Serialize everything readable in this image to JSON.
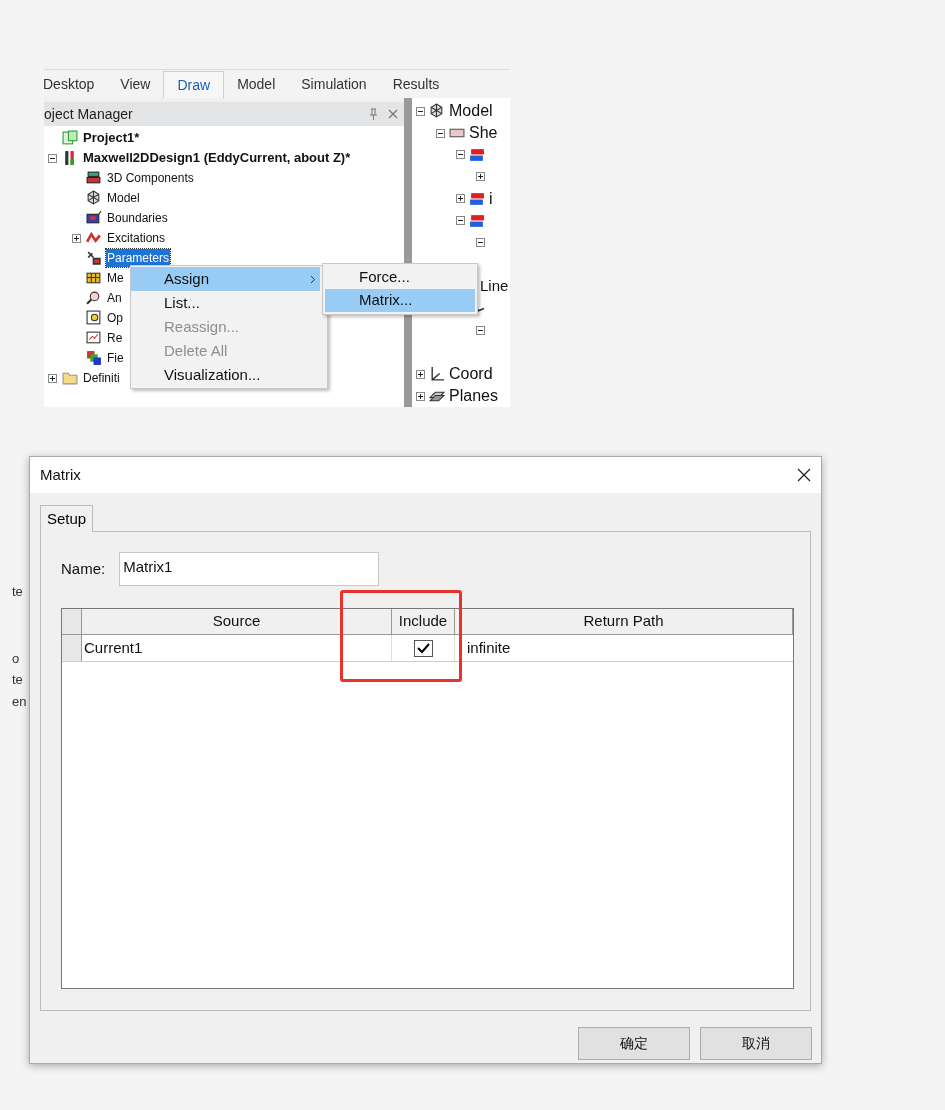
{
  "toolbar": {
    "ribbon_tabs": [
      {
        "label": "Desktop",
        "selected": false
      },
      {
        "label": "View",
        "selected": false
      },
      {
        "label": "Draw",
        "selected": true
      },
      {
        "label": "Model",
        "selected": false
      },
      {
        "label": "Simulation",
        "selected": false
      },
      {
        "label": "Results",
        "selected": false
      }
    ]
  },
  "project_manager": {
    "title": "oject Manager",
    "tree": [
      {
        "label": "Project1*",
        "kind": "project",
        "bold": true,
        "selected": false
      },
      {
        "label": "Maxwell2DDesign1 (EddyCurrent, about Z)*",
        "kind": "design",
        "bold": true,
        "expanded": true,
        "selected": false,
        "children": [
          {
            "label": "3D Components",
            "kind": "components",
            "selected": false
          },
          {
            "label": "Model",
            "kind": "model",
            "selected": false
          },
          {
            "label": "Boundaries",
            "kind": "boundaries",
            "selected": false
          },
          {
            "label": "Excitations",
            "kind": "excitations",
            "expanded": false,
            "selected": false
          },
          {
            "label": "Parameters",
            "kind": "parameters",
            "selected": true
          },
          {
            "label": "Me",
            "kind": "mesh",
            "selected": false
          },
          {
            "label": "An",
            "kind": "analysis",
            "selected": false
          },
          {
            "label": "Op",
            "kind": "optimetrics",
            "selected": false
          },
          {
            "label": "Re",
            "kind": "results",
            "selected": false
          },
          {
            "label": "Fie",
            "kind": "fields",
            "selected": false
          }
        ]
      },
      {
        "label": "Definiti",
        "kind": "folder",
        "expanded": false,
        "selected": false
      }
    ]
  },
  "model_tree": [
    {
      "label": "Model",
      "kind": "model",
      "expanded": true,
      "children": [
        {
          "label": "She",
          "kind": "sheet",
          "expanded": true,
          "children": [
            {
              "kind": "object",
              "expanded": true,
              "children": [
                {
                  "expanded": false
                }
              ]
            },
            {
              "label": "i",
              "kind": "object",
              "expanded": false
            },
            {
              "kind": "object",
              "expanded": true,
              "children": [
                {
                  "expanded": true
                }
              ]
            }
          ]
        },
        {
          "label": "Line",
          "children": [
            {
              "kind": "line",
              "children": [
                {
                  "expanded": true
                }
              ]
            }
          ]
        }
      ]
    },
    {
      "label": "Coord",
      "kind": "coord",
      "expanded": false
    },
    {
      "label": "Planes",
      "kind": "planes",
      "expanded": false
    }
  ],
  "context_menu": [
    {
      "label": "Assign",
      "highlighted": true,
      "submenu": true,
      "disabled": false
    },
    {
      "label": "List...",
      "highlighted": false,
      "submenu": false,
      "disabled": false
    },
    {
      "label": "Reassign...",
      "highlighted": false,
      "submenu": false,
      "disabled": true
    },
    {
      "label": "Delete All",
      "highlighted": false,
      "submenu": false,
      "disabled": true
    },
    {
      "label": "Visualization...",
      "highlighted": false,
      "submenu": false,
      "disabled": false
    }
  ],
  "submenu": [
    {
      "label": "Force...",
      "highlighted": false
    },
    {
      "label": "Matrix...",
      "highlighted": true
    }
  ],
  "background_fragments": [
    "te",
    "o",
    "te",
    "en"
  ],
  "dialog": {
    "title": "Matrix",
    "tabs": [
      {
        "label": "Setup",
        "selected": true
      }
    ],
    "name_label": "Name:",
    "name_value": "Matrix1",
    "table": {
      "columns": [
        "Source",
        "Include",
        "Return Path"
      ],
      "rows": [
        {
          "source": "Current1",
          "include": true,
          "return_path": "infinite"
        }
      ]
    },
    "buttons": [
      "确定",
      "取消"
    ]
  }
}
